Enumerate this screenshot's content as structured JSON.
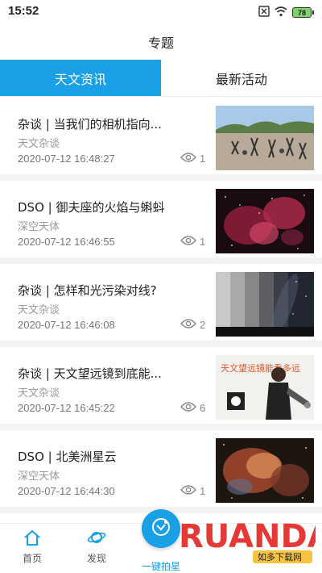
{
  "status_bar": {
    "time": "15:52",
    "battery": "78",
    "icons": [
      "sim-x-icon",
      "wifi-icon",
      "battery-icon"
    ]
  },
  "header": {
    "title": "专题"
  },
  "tabs": [
    {
      "label": "天文资讯",
      "active": true
    },
    {
      "label": "最新活动",
      "active": false
    }
  ],
  "articles": [
    {
      "title": "杂谈 | 当我们的相机指向...",
      "category": "天文杂谈",
      "date": "2020-07-12 16:48:27",
      "views": "1",
      "thumb": "telescopes-field"
    },
    {
      "title": "DSO | 御夫座的火焰与蝌蚪",
      "category": "深空天体",
      "date": "2020-07-12 16:46:55",
      "views": "1",
      "thumb": "red-nebula"
    },
    {
      "title": "杂谈 | 怎样和光污染对线?",
      "category": "天文杂谈",
      "date": "2020-07-12 16:46:08",
      "views": "2",
      "thumb": "milky-way-gradient"
    },
    {
      "title": "杂谈 | 天文望远镜到底能...",
      "category": "天文杂谈",
      "date": "2020-07-12 16:45:22",
      "views": "6",
      "thumb": "person-telescope"
    },
    {
      "title": "DSO | 北美洲星云",
      "category": "深空天体",
      "date": "2020-07-12 16:44:30",
      "views": "1",
      "thumb": "north-america-nebula"
    }
  ],
  "thumb_text": {
    "poster": "天文望远镜能看多远"
  },
  "bottom_nav": {
    "home": "首页",
    "discover": "发现",
    "camera": "一键拍星"
  },
  "watermark": {
    "brand": "RUANDADO",
    "sub": "如多下载网"
  },
  "colors": {
    "accent": "#1aa0e6"
  }
}
